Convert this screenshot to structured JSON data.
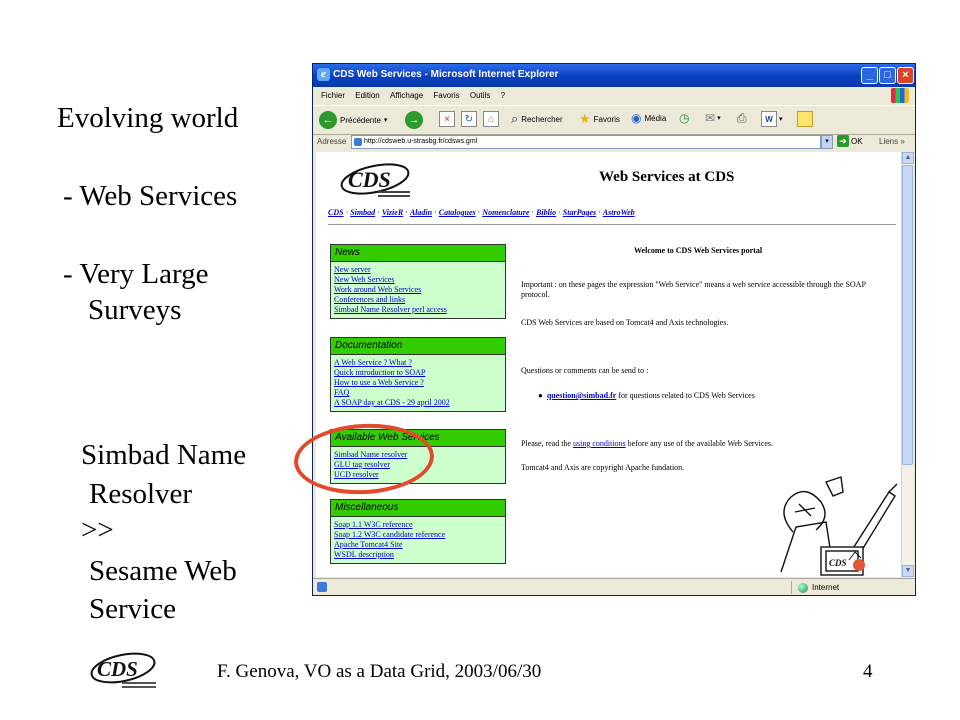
{
  "slide": {
    "heading": "Evolving world",
    "bullet1": "- Web Services",
    "bullet2_line1": "- Very Large",
    "bullet2_line2": "Surveys",
    "side_line1": "Simbad Name",
    "side_line2": "Resolver",
    "side_line3": ">>",
    "side_line4": "Sesame Web",
    "side_line5": "Service",
    "footer": "F. Genova, VO as a Data Grid, 2003/06/30",
    "page_number": "4"
  },
  "browser": {
    "window_title": "CDS Web Services - Microsoft Internet Explorer",
    "menu": [
      "Fichier",
      "Edition",
      "Affichage",
      "Favoris",
      "Outils",
      "?"
    ],
    "toolbar": {
      "back": "Précédente",
      "search": "Rechercher",
      "favorites": "Favoris",
      "media": "Média"
    },
    "address_label": "Adresse",
    "address_value": "http://cdsweb.u-strasbg.fr/cdsws.gml",
    "go_label": "OK",
    "links_label": "Liens",
    "links_chevron": "»",
    "status_zone": "Internet"
  },
  "page": {
    "title": "Web Services at CDS",
    "nav": [
      "CDS",
      "Simbad",
      "VizieR",
      "Aladin",
      "Catalogues",
      "Nomenclature",
      "Biblio",
      "StarPages",
      "AstroWeb"
    ],
    "welcome": "Welcome to CDS Web Services portal",
    "para1": "Important : on these pages the expression \"Web Service\" means a web service accessible through the SOAP protocol.",
    "para2": "CDS Web Services are based on Tomcat4 and Axis technologies.",
    "para3": "Questions or comments can be send to :",
    "email": "question@simbad.fr",
    "email_suffix": " for questions related to CDS Web Services",
    "para4_prefix": "Please, read the ",
    "para4_link": "using conditions",
    "para4_suffix": " before any use of the available Web Services.",
    "para5": "Tomcat4 and Axis are copyright Apache fundation.",
    "boxes": {
      "news": {
        "title": "News",
        "items": [
          "New server",
          "New Web Services",
          "Work around Web Services",
          "Conferences and links",
          "Simbad Name Resolver perl access"
        ]
      },
      "documentation": {
        "title": "Documentation",
        "items": [
          "A Web Service ? What ?",
          "Quick introduction to SOAP",
          "How to use a Web Service ?",
          "FAQ",
          "A SOAP day at CDS - 29 april 2002"
        ]
      },
      "services": {
        "title": "Available Web Services",
        "items": [
          "Simbad Name resolver",
          "GLU tag resolver",
          "UCD resolver"
        ]
      },
      "misc": {
        "title": "Miscellaneous",
        "items": [
          "Soap 1.1 W3C reference",
          "Soap 1.2 W3C candidate reference",
          "Apache Tomcat4 Site",
          "WSDL description"
        ]
      }
    }
  },
  "colors": {
    "box_header": "#33cc00",
    "box_body": "#ccffcc",
    "link": "#0000cc",
    "highlight": "#e24a2a",
    "titlebar": "#0a3fc2"
  }
}
